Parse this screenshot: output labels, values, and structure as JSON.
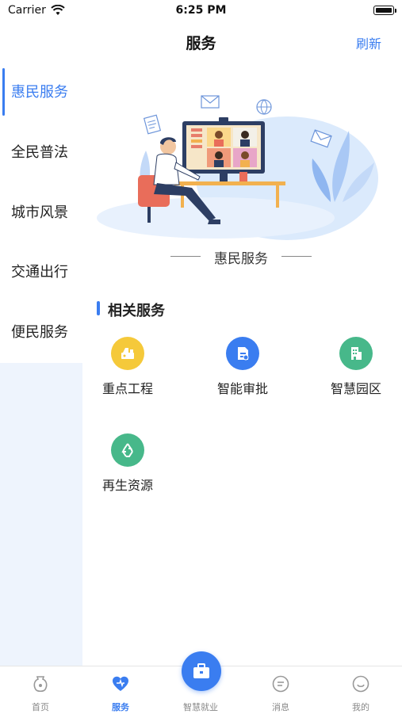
{
  "status_bar": {
    "carrier": "Carrier",
    "time": "6:25 PM"
  },
  "nav": {
    "title": "服务",
    "refresh_label": "刷新"
  },
  "sidebar": {
    "items": [
      {
        "label": "惠民服务",
        "active": true
      },
      {
        "label": "全民普法",
        "active": false
      },
      {
        "label": "城市风景",
        "active": false
      },
      {
        "label": "交通出行",
        "active": false
      },
      {
        "label": "便民服务",
        "active": false
      }
    ]
  },
  "banner": {
    "caption": "惠民服务"
  },
  "section": {
    "title": "相关服务",
    "services": [
      {
        "label": "重点工程",
        "icon": "construction-icon",
        "color": "#f5c93a"
      },
      {
        "label": "智能审批",
        "icon": "approval-document-icon",
        "color": "#3a7df0"
      },
      {
        "label": "智慧园区",
        "icon": "building-park-icon",
        "color": "#47b88a"
      },
      {
        "label": "再生资源",
        "icon": "recycle-icon",
        "color": "#47b88a"
      }
    ]
  },
  "tabbar": {
    "tabs": [
      {
        "label": "首页",
        "icon": "vase-icon",
        "active": false
      },
      {
        "label": "服务",
        "icon": "heart-icon",
        "active": true
      },
      {
        "label": "智慧就业",
        "icon": "briefcase-icon",
        "active": false
      },
      {
        "label": "消息",
        "icon": "message-icon",
        "active": false
      },
      {
        "label": "我的",
        "icon": "smile-icon",
        "active": false
      }
    ]
  },
  "colors": {
    "accent": "#3a7df0",
    "sidebar_bg": "#eef4fd"
  }
}
